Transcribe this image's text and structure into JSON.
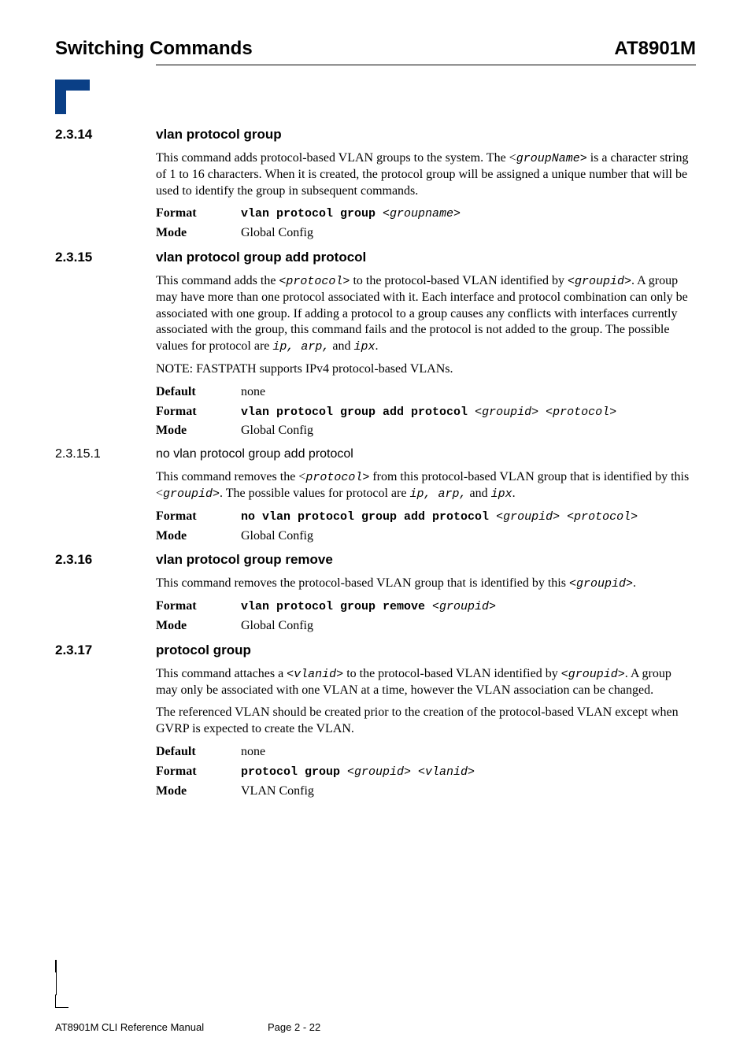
{
  "header": {
    "left": "Switching Commands",
    "right": "AT8901M"
  },
  "sections": [
    {
      "num": "2.3.14",
      "title": "vlan protocol group",
      "paras": [
        {
          "runs": [
            {
              "t": "This command adds protocol-based VLAN groups to the system. The <"
            },
            {
              "t": "groupName>",
              "cls": "mono-i"
            },
            {
              "t": " is a character string of 1 to 16 characters.   When it is created, the protocol group will be assigned a unique number that will be used to identify the group in subsequent commands."
            }
          ]
        }
      ],
      "kvs": [
        {
          "k": "Format",
          "runs": [
            {
              "t": "vlan protocol group ",
              "cls": "mono-b"
            },
            {
              "t": "<groupname>",
              "cls": "mono-i"
            }
          ]
        },
        {
          "k": "Mode",
          "runs": [
            {
              "t": "Global Config"
            }
          ]
        }
      ]
    },
    {
      "num": "2.3.15",
      "title": "vlan protocol group add protocol",
      "paras": [
        {
          "runs": [
            {
              "t": "This command adds the "
            },
            {
              "t": "<protocol>",
              "cls": "mono-i"
            },
            {
              "t": " to the protocol-based VLAN identified by "
            },
            {
              "t": "<groupid>",
              "cls": "mono-i"
            },
            {
              "t": ". A group may have more than one protocol associated with it. Each interface and protocol combination can only be associated with one group. If adding a protocol to a group causes any conflicts with interfaces currently associated with the group, this command fails and the protocol is not added to the group. The possible values for protocol are "
            },
            {
              "t": "ip, arp,",
              "cls": "mono-i"
            },
            {
              "t": " and "
            },
            {
              "t": "ipx",
              "cls": "mono-i"
            },
            {
              "t": "."
            }
          ]
        }
      ],
      "note": {
        "label": "NOTE:",
        "text": "FASTPATH supports IPv4 protocol-based VLANs."
      },
      "kvs": [
        {
          "k": "Default",
          "runs": [
            {
              "t": "none"
            }
          ]
        },
        {
          "k": "Format",
          "runs": [
            {
              "t": "vlan protocol group add protocol ",
              "cls": "mono-b"
            },
            {
              "t": "<groupid> <protocol>",
              "cls": "mono-i"
            }
          ]
        },
        {
          "k": "Mode",
          "runs": [
            {
              "t": "Global Config"
            }
          ]
        }
      ]
    },
    {
      "num": "2.3.15.1",
      "title": "no vlan protocol group add protocol",
      "sub": true,
      "paras": [
        {
          "runs": [
            {
              "t": "This command removes the <"
            },
            {
              "t": "protocol>",
              "cls": "mono-i"
            },
            {
              "t": " from this protocol-based VLAN group that is identified by this <"
            },
            {
              "t": "groupid>",
              "cls": "mono-i"
            },
            {
              "t": ". The possible values for protocol are "
            },
            {
              "t": "ip, arp,",
              "cls": "mono-i"
            },
            {
              "t": " and "
            },
            {
              "t": "ipx",
              "cls": "mono-i"
            },
            {
              "t": "."
            }
          ]
        }
      ],
      "kvs": [
        {
          "k": "Format",
          "runs": [
            {
              "t": "no vlan protocol group add protocol ",
              "cls": "mono-b"
            },
            {
              "t": "<groupid> <protocol>",
              "cls": "mono-i"
            }
          ]
        },
        {
          "k": "Mode",
          "runs": [
            {
              "t": "Global Config"
            }
          ]
        }
      ]
    },
    {
      "num": "2.3.16",
      "title": "vlan protocol group remove",
      "paras": [
        {
          "runs": [
            {
              "t": "This command removes the protocol-based VLAN group that is identified by this "
            },
            {
              "t": "<groupid>",
              "cls": "mono-i"
            },
            {
              "t": "."
            }
          ]
        }
      ],
      "kvs": [
        {
          "k": "Format",
          "runs": [
            {
              "t": "vlan protocol group remove ",
              "cls": "mono-b"
            },
            {
              "t": "<groupid>",
              "cls": "mono-i"
            }
          ]
        },
        {
          "k": "Mode",
          "runs": [
            {
              "t": "Global Config"
            }
          ]
        }
      ]
    },
    {
      "num": "2.3.17",
      "title": "protocol group",
      "paras": [
        {
          "runs": [
            {
              "t": "This command attaches a "
            },
            {
              "t": "<vlanid>",
              "cls": "mono-i"
            },
            {
              "t": " to the protocol-based VLAN identified by "
            },
            {
              "t": "<groupid>",
              "cls": "mono-i"
            },
            {
              "t": ".   A group may only be associated with one VLAN at a time, however the VLAN association can be changed."
            }
          ]
        },
        {
          "runs": [
            {
              "t": "The referenced VLAN should be created prior to the creation of the protocol-based VLAN except when GVRP is expected to create the VLAN."
            }
          ]
        }
      ],
      "kvs": [
        {
          "k": "Default",
          "runs": [
            {
              "t": "none"
            }
          ]
        },
        {
          "k": "Format",
          "runs": [
            {
              "t": "protocol group ",
              "cls": "mono-b"
            },
            {
              "t": "<groupid> <vlanid>",
              "cls": "mono-i"
            }
          ]
        },
        {
          "k": "Mode",
          "runs": [
            {
              "t": "VLAN Config"
            }
          ]
        }
      ]
    }
  ],
  "footer": {
    "left": "AT8901M CLI Reference Manual",
    "right": "Page 2 - 22"
  }
}
